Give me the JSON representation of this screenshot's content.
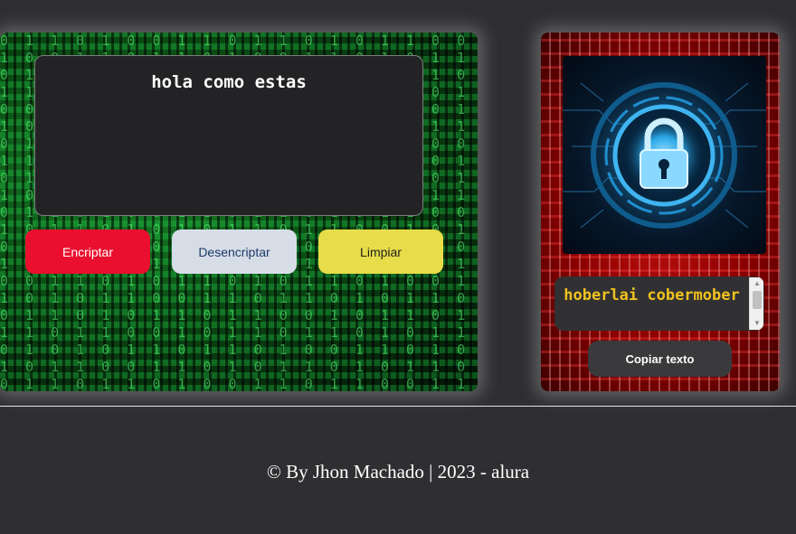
{
  "input": {
    "value": "hola como estas"
  },
  "buttons": {
    "encrypt": "Encriptar",
    "decrypt": "Desencriptar",
    "clear": "Limpiar"
  },
  "output": {
    "value": "hoberlai cobermober",
    "copy_label": "Copiar texto"
  },
  "footer": {
    "text": "© By Jhon Machado | 2023 - alura"
  },
  "colors": {
    "background": "#2f2e31",
    "encrypt_button": "#ea0f2e",
    "decrypt_button": "#d7dde7",
    "clear_button": "#e7dc49",
    "output_text": "#f1c21f"
  },
  "icons": {
    "left_background": "matrix-code-background",
    "right_background": "red-circuit-background",
    "lock": "padlock-icon"
  }
}
